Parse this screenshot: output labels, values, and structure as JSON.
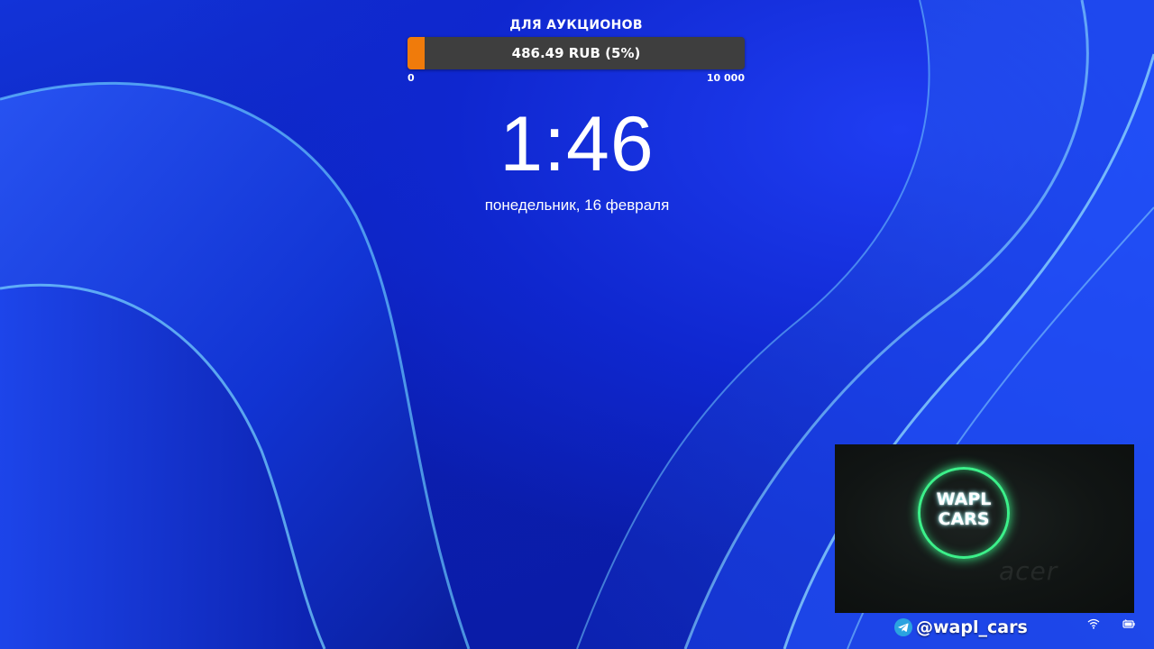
{
  "goal": {
    "title": "ДЛЯ АУКЦИОНОВ",
    "amount_text": "486.49 RUB (5%)",
    "progress_percent": 5,
    "scale_min": "0",
    "scale_max": "10 000",
    "fill_color": "#f07b0b",
    "bar_color": "#3e3e3e"
  },
  "lockscreen": {
    "time": "1:46",
    "date": "понедельник, 16 февраля"
  },
  "webcam": {
    "logo_text": "WAPL CARS",
    "brand_text": "acer",
    "ring_color": "#3cf08a"
  },
  "social": {
    "icon": "telegram-icon",
    "handle": "@wapl_cars"
  },
  "tray": {
    "icons": [
      "wifi-icon",
      "battery-icon"
    ]
  },
  "colors": {
    "wallpaper_base": "#0b1fb2",
    "wallpaper_highlight": "#58c4ff"
  }
}
